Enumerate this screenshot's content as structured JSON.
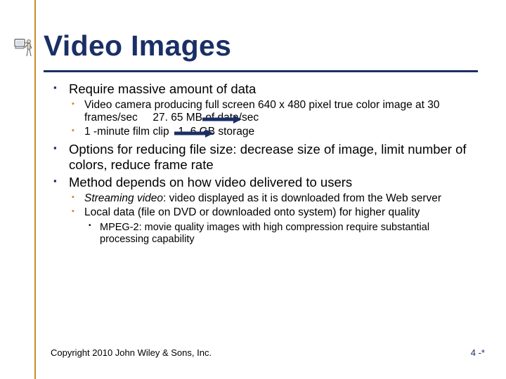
{
  "title": "Video Images",
  "bullets": {
    "b1": "Require massive amount of data",
    "b1a_part1": "Video camera producing full screen 640 x 480 pixel true color image at 30 frames/sec",
    "b1a_part2": "27. 65 MB of data/sec",
    "b1b_part1": "1 -minute film clip",
    "b1b_part2": "1. 6 GB storage",
    "b2": "Options for reducing file size: decrease size of image, limit number of colors, reduce frame rate",
    "b3": "Method depends on how video delivered to users",
    "b3a_term": "Streaming video",
    "b3a_rest": ": video displayed as it is downloaded from the Web server",
    "b3b": "Local data (file on DVD or downloaded onto system) for higher quality",
    "b3b_i": "MPEG-2: movie quality images with high compression require substantial processing capability"
  },
  "footer": {
    "copyright": "Copyright 2010 John Wiley & Sons, Inc.",
    "slidenum": "4 -*"
  },
  "colors": {
    "accent_blue": "#1a2f66",
    "accent_tan": "#c98a2b"
  }
}
